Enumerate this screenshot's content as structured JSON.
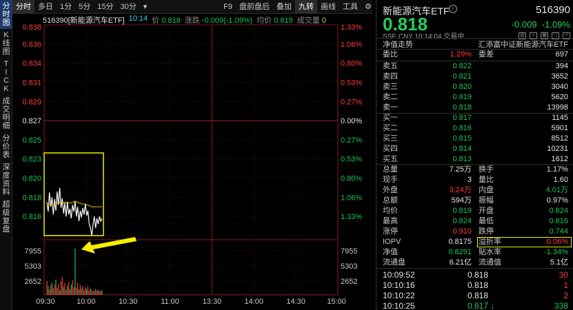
{
  "vtabs": [
    "分\n时\n图",
    "K\n线\n图",
    "T\nI\nC\nK",
    "成\n交\n明\n细",
    "分\n价\n表",
    "深\n度\n资\n料",
    "超\n级\n复\n盘"
  ],
  "toolbar": {
    "items": [
      "分时",
      "多日",
      "1分",
      "5分",
      "15分",
      "30分"
    ],
    "more_icon": "▾",
    "right_items": [
      "F9",
      "盘前盘后",
      "叠加",
      "九转",
      "画线",
      "工具"
    ],
    "gear_icon": "⚙"
  },
  "infoline": {
    "code_name": "516390[新能源汽车ETF]",
    "time": "10:14",
    "price_label": "价",
    "price": "0.818",
    "change_label": "涨跌",
    "change": "-0.009(-1.09%)",
    "avg_label": "均价",
    "avg": "0.819",
    "volume_label": "成交量",
    "volume": "0"
  },
  "chart_data": {
    "type": "line",
    "price_axis": {
      "labels_up": [
        "0.838",
        "0.836",
        "0.834",
        "0.831",
        "0.829"
      ],
      "label_mid": "0.827",
      "labels_down": [
        "0.825",
        "0.823",
        "0.820",
        "0.818",
        "0.816"
      ],
      "ylim": [
        0.816,
        0.838
      ]
    },
    "pct_axis": {
      "labels_up": [
        "1.33%",
        "1.06%",
        "0.80%",
        "0.53%",
        "0.27%"
      ],
      "label_mid": "0.00%",
      "labels_down": [
        "0.27%",
        "0.53%",
        "0.80%",
        "1.06%",
        "1.33%"
      ]
    },
    "volume_axis": [
      "7955",
      "5303",
      "2652"
    ],
    "time_axis": [
      "09:30",
      "10:00",
      "10:30",
      "11:00",
      "13:30",
      "14:00",
      "14:30",
      "15:00"
    ],
    "series": [
      {
        "values": [
          0.8195,
          0.8185,
          0.8205,
          0.819,
          0.82,
          0.8182,
          0.8198,
          0.8186,
          0.8206,
          0.8192,
          0.821,
          0.8189,
          0.8199,
          0.8183,
          0.8194,
          0.818,
          0.8195,
          0.8182,
          0.8188,
          0.8178,
          0.8192,
          0.8185,
          0.8196,
          0.818,
          0.819,
          0.8175,
          0.8186,
          0.8179,
          0.8189,
          0.8182,
          0.8193,
          0.8181,
          0.8186,
          0.8172,
          0.8168,
          0.816,
          0.8172,
          0.818,
          0.8168,
          0.8178,
          0.8172,
          0.818,
          0.8175,
          0.8178
        ]
      },
      {
        "values": [
          0.8192,
          0.8191,
          0.8193,
          0.8192,
          0.8193,
          0.8192,
          0.8193,
          0.8192,
          0.8194,
          0.8193,
          0.8195,
          0.8194,
          0.8195,
          0.8194,
          0.8195,
          0.8194,
          0.8195,
          0.8194,
          0.8194,
          0.8194,
          0.8195,
          0.8195,
          0.8196,
          0.8195,
          0.8195,
          0.8194,
          0.8194,
          0.8193,
          0.8193,
          0.8193,
          0.8193,
          0.8192,
          0.8192,
          0.8191,
          0.8191,
          0.819,
          0.819,
          0.819,
          0.819,
          0.819,
          0.819,
          0.819,
          0.819,
          0.819
        ]
      }
    ],
    "volumes": [
      2400,
      1500,
      900,
      1700,
      2100,
      1100,
      1800,
      2600,
      1200,
      1900,
      800,
      2300,
      3100,
      1400,
      2000,
      900,
      1600,
      2200,
      1000,
      1800,
      2500,
      1300,
      7955,
      1200,
      2100,
      900,
      1700,
      1100,
      1500,
      800,
      1300,
      1000,
      1400,
      700,
      1100,
      900,
      600,
      800,
      1000,
      700,
      900,
      600,
      800,
      700
    ],
    "volume_max": 9000,
    "highlight_color": "#f4f000",
    "line_color": "#ffffff",
    "avg_color": "#e6b800",
    "down_color": "#19c45a",
    "up_color": "#ff3b3b",
    "mid_color": "#e6e6e6"
  },
  "panel": {
    "name": "新能源汽车ETF",
    "code": "516390",
    "price": "0.818",
    "change": "-0.009",
    "change_pct": "-1.09%",
    "sub": "SSE CNY 10:14:04 交易中",
    "tab_left": "净值走势",
    "tab_right": "汇添富中证新能源汽车ETF",
    "ratio": {
      "label": "委比",
      "value": "1.29%",
      "label2": "委差",
      "value2": "697"
    },
    "asks": [
      {
        "label": "卖五",
        "price": "0.822",
        "vol": "394"
      },
      {
        "label": "卖四",
        "price": "0.821",
        "vol": "3652"
      },
      {
        "label": "卖三",
        "price": "0.820",
        "vol": "3040"
      },
      {
        "label": "卖二",
        "price": "0.819",
        "vol": "5620"
      },
      {
        "label": "卖一",
        "price": "0.818",
        "vol": "13998"
      }
    ],
    "bids": [
      {
        "label": "买一",
        "price": "0.817",
        "vol": "1145"
      },
      {
        "label": "买二",
        "price": "0.816",
        "vol": "5901"
      },
      {
        "label": "买三",
        "price": "0.815",
        "vol": "8512"
      },
      {
        "label": "买四",
        "price": "0.814",
        "vol": "10231"
      },
      {
        "label": "买五",
        "price": "0.813",
        "vol": "1612"
      }
    ],
    "stats": [
      {
        "l1": "总量",
        "v1": "7.25万",
        "c1": "#e6e6e6",
        "l2": "换手",
        "v2": "1.17%",
        "c2": "#e6e6e6"
      },
      {
        "l1": "现手",
        "v1": "3",
        "c1": "#e6e6e6",
        "l2": "量比",
        "v2": "1.60",
        "c2": "#e6e6e6"
      },
      {
        "l1": "外盘",
        "v1": "3.24万",
        "c1": "#ff3b3b",
        "l2": "内盘",
        "v2": "4.01万",
        "c2": "#19c45a"
      },
      {
        "l1": "总额",
        "v1": "594万",
        "c1": "#e6e6e6",
        "l2": "振幅",
        "v2": "0.97%",
        "c2": "#e6e6e6"
      },
      {
        "l1": "均价",
        "v1": "0.819",
        "c1": "#19c45a",
        "l2": "开盘",
        "v2": "0.824",
        "c2": "#19c45a"
      },
      {
        "l1": "最高",
        "v1": "0.824",
        "c1": "#19c45a",
        "l2": "最低",
        "v2": "0.816",
        "c2": "#19c45a"
      },
      {
        "l1": "涨停",
        "v1": "0.910",
        "c1": "#ff3b3b",
        "l2": "跌停",
        "v2": "0.744",
        "c2": "#19c45a"
      },
      {
        "l1": "IOPV",
        "v1": "0.8175",
        "c1": "#e6e6e6",
        "l2": "溢折率",
        "v2": "0.06%",
        "c2": "#ff3b3b"
      },
      {
        "l1": "净值",
        "v1": "0.8291",
        "c1": "#19c45a",
        "l2": "贴水率",
        "v2": "-1.34%",
        "c2": "#19c45a"
      },
      {
        "l1": "流通盘",
        "v1": "6.21亿",
        "c1": "#e6e6e6",
        "l2": "流通值",
        "v2": "5.1亿",
        "c2": "#e6e6e6"
      }
    ],
    "ticks": [
      {
        "time": "10:09:52",
        "price": "0.818",
        "vol": "30",
        "color": "#ff3b3b"
      },
      {
        "time": "10:10:16",
        "price": "0.818",
        "vol": "1",
        "color": "#ff3b3b"
      },
      {
        "time": "10:10:22",
        "price": "0.818",
        "vol": "2",
        "color": "#ff3b3b"
      },
      {
        "time": "10:10:25",
        "price": "0.817 ↓",
        "vol": "338",
        "color": "#19c45a"
      }
    ]
  }
}
